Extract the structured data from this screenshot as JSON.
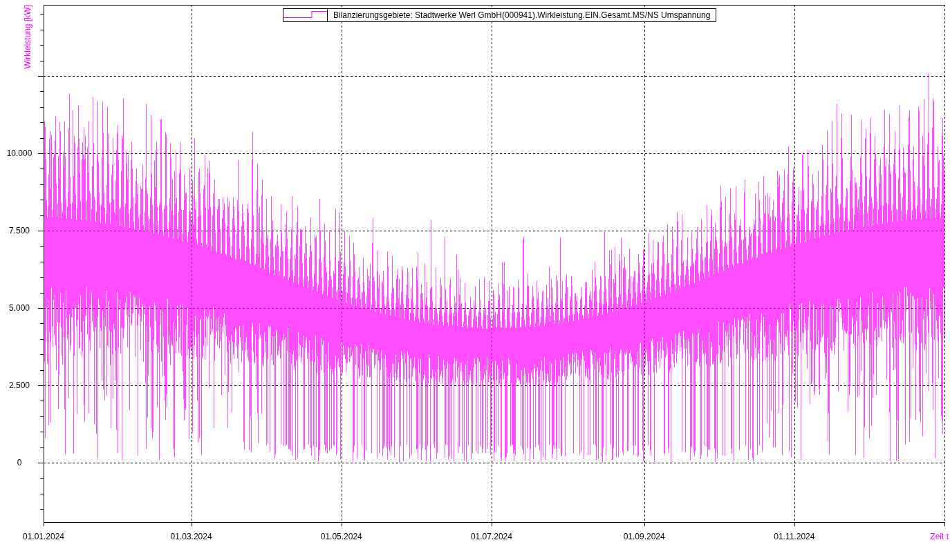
{
  "chart": {
    "legend": {
      "label": "Bilanzierungsgebiete: Stadtwerke Werl GmbH(000941).Wirkleistung.EIN.Gesamt.MS/NS Umspannung"
    },
    "y_axis": {
      "label": "Wirkleistung [kW]",
      "ticks": [
        "10.000",
        "7.500",
        "5.000",
        "2.500",
        "0"
      ]
    },
    "x_axis": {
      "label": "Zeit t",
      "ticks": [
        "01.01.2024",
        "01.03.2024",
        "01.05.2024",
        "01.07.2024",
        "01.09.2024",
        "01.11.2024"
      ]
    }
  }
}
